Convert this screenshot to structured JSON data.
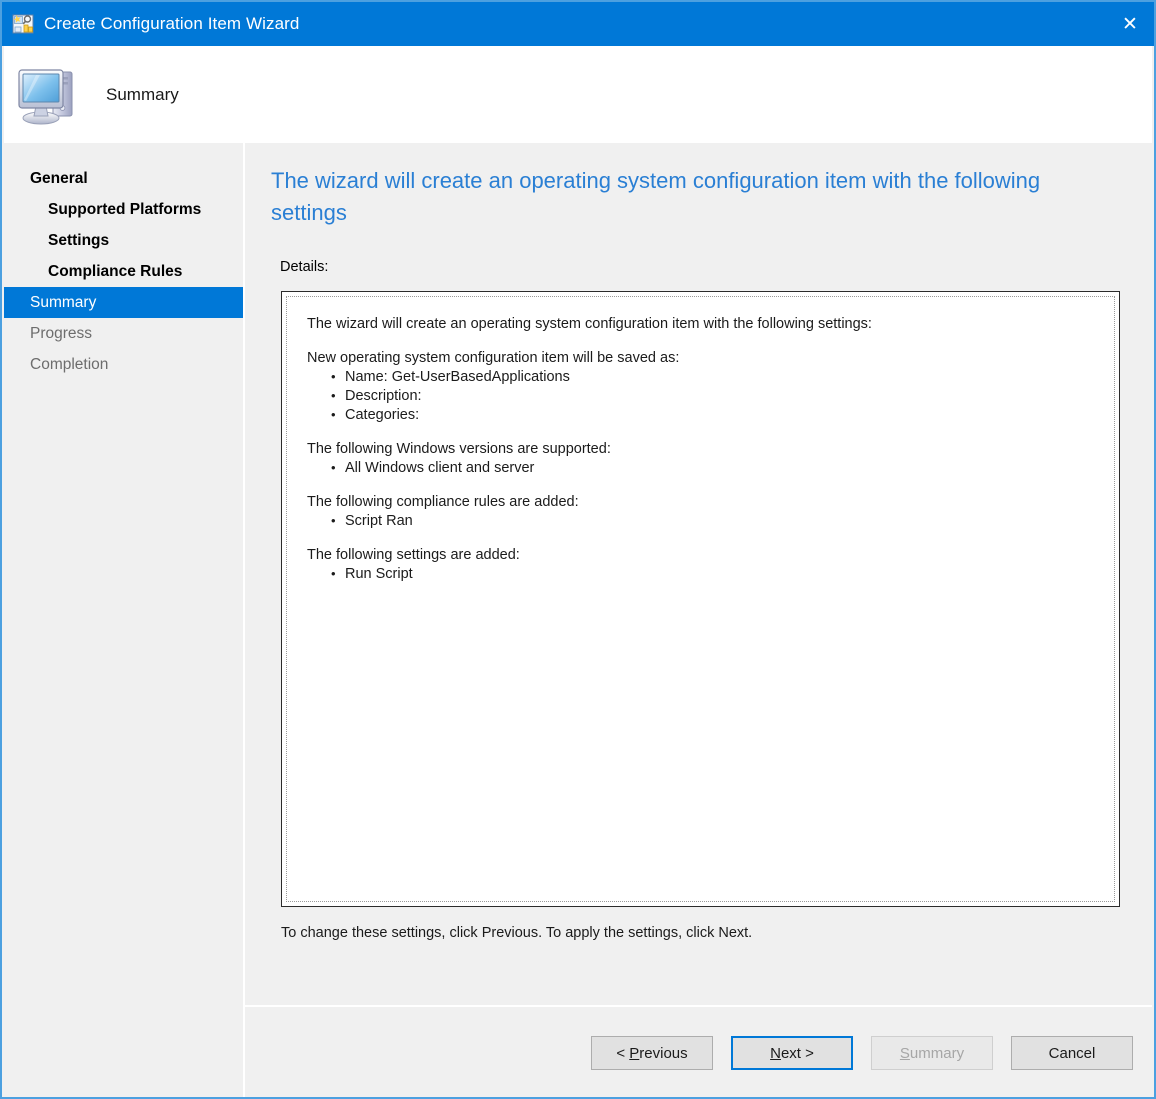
{
  "window": {
    "title": "Create Configuration Item Wizard",
    "title_icon": "configuration-item-icon",
    "close_icon": "✕",
    "accent_color": "#0078d7",
    "border_color": "#4ca0e0"
  },
  "banner": {
    "icon": "computer-monitor-icon",
    "title": "Summary"
  },
  "sidebar": {
    "items": [
      {
        "label": "General",
        "level": 0,
        "state": "bold"
      },
      {
        "label": "Supported Platforms",
        "level": 1,
        "state": "normal"
      },
      {
        "label": "Settings",
        "level": 1,
        "state": "normal"
      },
      {
        "label": "Compliance Rules",
        "level": 1,
        "state": "normal"
      },
      {
        "label": "Summary",
        "level": 0,
        "state": "selected"
      },
      {
        "label": "Progress",
        "level": 0,
        "state": "disabled"
      },
      {
        "label": "Completion",
        "level": 0,
        "state": "disabled"
      }
    ]
  },
  "content": {
    "heading": "The wizard will create an operating system configuration item with the following settings",
    "heading_color": "#2a7fd4",
    "details_label": "Details:",
    "details": {
      "intro": "The wizard will create an operating system configuration item with the following settings:",
      "sections": [
        {
          "heading": "New operating system configuration item will be saved as:",
          "items": [
            "Name: Get-UserBasedApplications",
            "Description:",
            "Categories:"
          ]
        },
        {
          "heading": "The following Windows versions are supported:",
          "items": [
            "All Windows client and server"
          ]
        },
        {
          "heading": "The following compliance rules are added:",
          "items": [
            "Script Ran"
          ]
        },
        {
          "heading": "The following settings are added:",
          "items": [
            "Run Script"
          ]
        }
      ]
    },
    "change_note": "To change these settings, click Previous. To apply the settings, click Next."
  },
  "footer": {
    "buttons": [
      {
        "name": "previous",
        "prefix": "< ",
        "accel": "P",
        "suffix": "revious",
        "state": "normal"
      },
      {
        "name": "next",
        "prefix": "",
        "accel": "N",
        "suffix": "ext >",
        "state": "focused"
      },
      {
        "name": "summary",
        "prefix": "",
        "accel": "S",
        "suffix": "ummary",
        "state": "disabled"
      },
      {
        "name": "cancel",
        "prefix": "",
        "accel": "",
        "suffix": "Cancel",
        "state": "normal"
      }
    ]
  }
}
